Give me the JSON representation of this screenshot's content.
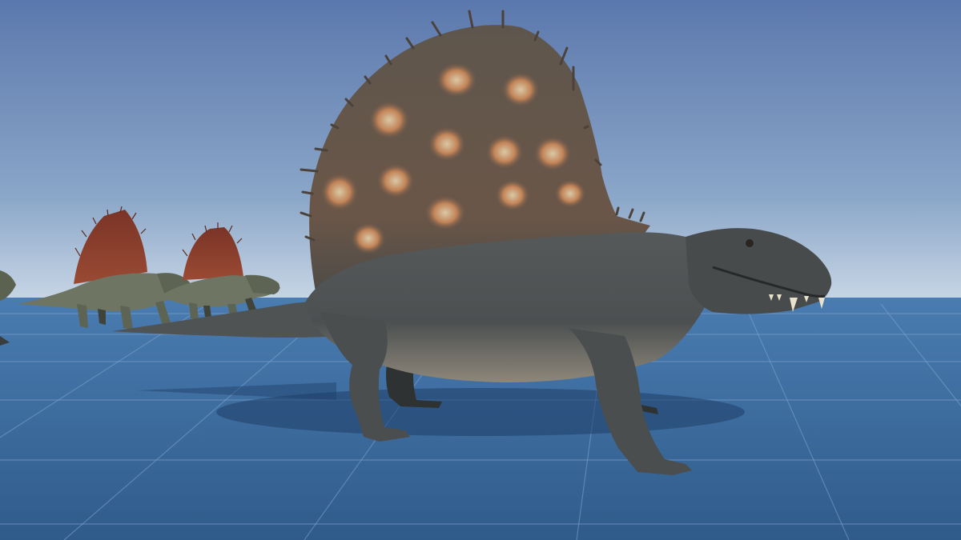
{
  "scene": {
    "type": "3d-engine-viewport",
    "subjects": [
      {
        "name": "dimetrodon-large",
        "count": 1
      },
      {
        "name": "dimetrodon-background",
        "count": 2
      },
      {
        "name": "partial-creature-left-edge",
        "count": 1
      }
    ]
  },
  "colors": {
    "sky_top": "#5b78ad",
    "sky_horizon": "#c9d7e6",
    "ground_near": "#2f5b8a",
    "ground_far": "#4a7cb1",
    "grid_line": "#7fa3cc",
    "body_main": "#55595a",
    "body_dark": "#3a3d3e",
    "sail_main": "#6a5648",
    "sail_spot": "#c28357",
    "sail_spot_center": "#d9c9a6",
    "belly": "#8e877a",
    "bg_body": "#6e7563",
    "bg_sail": "#8a3a2b",
    "teeth": "#e9e2cc",
    "shadow": "#1f3e68"
  }
}
